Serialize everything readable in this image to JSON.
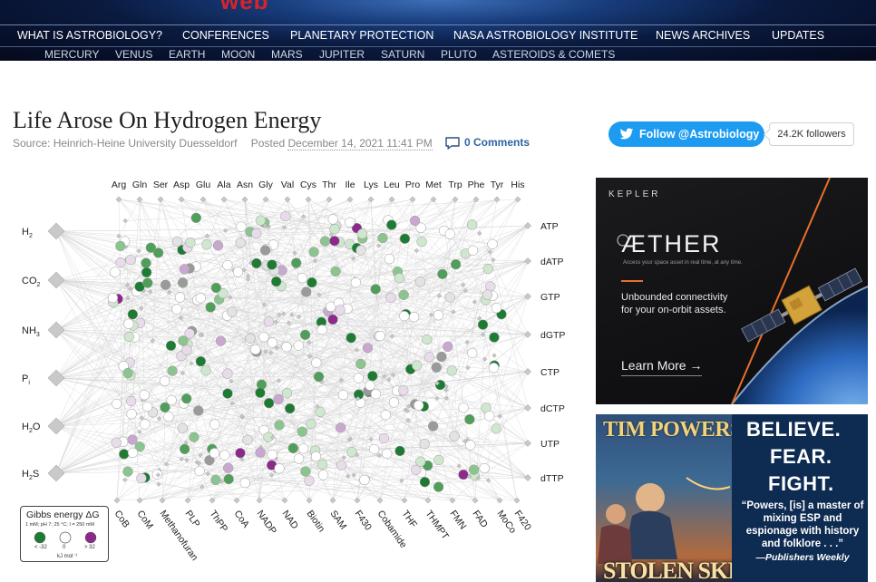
{
  "header": {
    "logo_fragment": "web",
    "main_nav": [
      "WHAT IS ASTROBIOLOGY?",
      "CONFERENCES",
      "PLANETARY PROTECTION",
      "NASA ASTROBIOLOGY INSTITUTE",
      "NEWS ARCHIVES",
      "UPDATES"
    ],
    "sub_nav": [
      "MERCURY",
      "VENUS",
      "EARTH",
      "MOON",
      "MARS",
      "JUPITER",
      "SATURN",
      "PLUTO",
      "ASTEROIDS & COMETS"
    ]
  },
  "article": {
    "title": "Life Arose On Hydrogen Energy",
    "source": "Source: Heinrich-Heine University Duesseldorf",
    "posted_label": "Posted",
    "date": "December 14, 2021 11:41 PM",
    "comments": "0 Comments"
  },
  "twitter": {
    "follow_label": "Follow @Astrobiology",
    "followers": "24.2K followers"
  },
  "figure": {
    "top_labels": [
      "Arg",
      "Gln",
      "Ser",
      "Asp",
      "Glu",
      "Ala",
      "Asn",
      "Gly",
      "Val",
      "Cys",
      "Thr",
      "Ile",
      "Lys",
      "Leu",
      "Pro",
      "Met",
      "Trp",
      "Phe",
      "Tyr",
      "His"
    ],
    "left_labels": [
      "H2",
      "CO2",
      "NH3",
      "Pi",
      "H2O",
      "H2S"
    ],
    "right_labels": [
      "ATP",
      "dATP",
      "GTP",
      "dGTP",
      "CTP",
      "dCTP",
      "UTP",
      "dTTP"
    ],
    "bottom_labels": [
      "CoB",
      "CoM",
      "Methanofuran",
      "PLP",
      "ThPP",
      "CoA",
      "NADP",
      "NAD",
      "Biotin",
      "SAM",
      "F430",
      "Cobamide",
      "THF",
      "THMPT",
      "FMN",
      "FAD",
      "MoCo",
      "F420"
    ],
    "legend": {
      "title": "Gibbs energy ΔG",
      "conditions": "1 mM; pH 7; 25 °C; I = 250 mM",
      "low": "< -32",
      "mid": "0",
      "high": "> 32",
      "unit": "kJ mol⁻¹",
      "colors": {
        "exergonic": "#1e7b34",
        "neutral": "#ffffff",
        "endergonic": "#8b2a8b"
      }
    }
  },
  "ads": {
    "kepler": {
      "brand": "KEPLER",
      "product": "ÆTHER",
      "tagline": "Access your space asset in real time, at any time.",
      "line1": "Unbounded connectivity",
      "line2": "for your on-orbit assets.",
      "cta": "Learn More →"
    },
    "book": {
      "author": "TIM POWERS",
      "book_title": "STOLEN SKIES",
      "word1": "BELIEVE.",
      "word2": "FEAR.",
      "word3": "FIGHT.",
      "quote": "“Powers, [is] a master of mixing ESP and espionage with history and folklore . . .”",
      "publisher": "—Publishers Weekly"
    }
  }
}
